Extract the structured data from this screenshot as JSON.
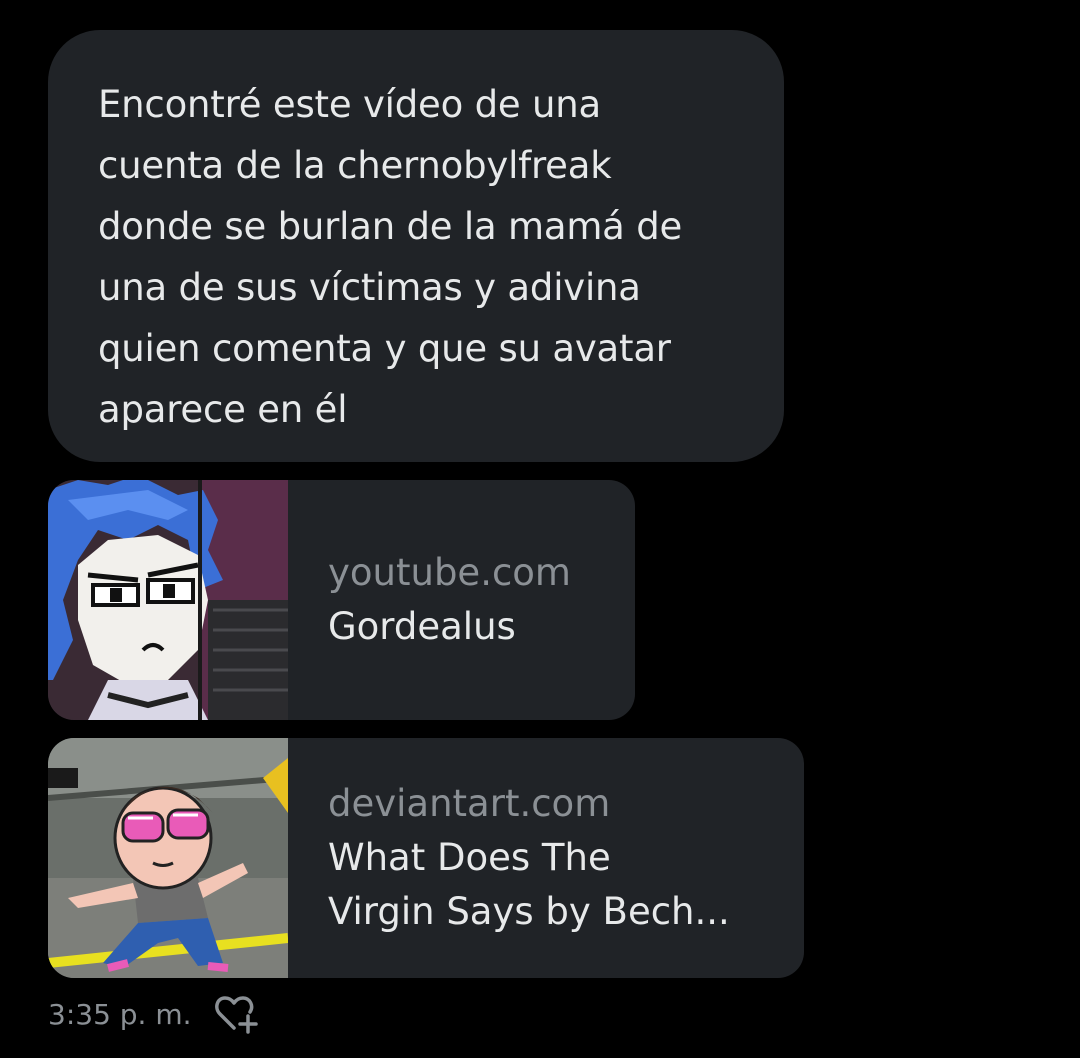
{
  "message": {
    "text": "Encontré este vídeo de una\ncuenta de la chernobylfreak\ndonde se burlan de la mamá de\nuna de sus víctimas y adivina\nquien comenta y que su avatar\naparece en él"
  },
  "link_cards": [
    {
      "domain": "youtube.com",
      "title": "Gordealus",
      "thumbnail_icon": "anime-character-thumbnail"
    },
    {
      "domain": "deviantart.com",
      "title": "What Does The\nVirgin Says by Bech...",
      "thumbnail_icon": "cartoon-character-thumbnail"
    }
  ],
  "footer": {
    "timestamp": "3:35 p. m.",
    "react_icon": "heart-plus-icon"
  },
  "colors": {
    "background": "#000000",
    "bubble": "#202327",
    "text_primary": "#e7e9ea",
    "text_secondary": "#8b9095"
  }
}
